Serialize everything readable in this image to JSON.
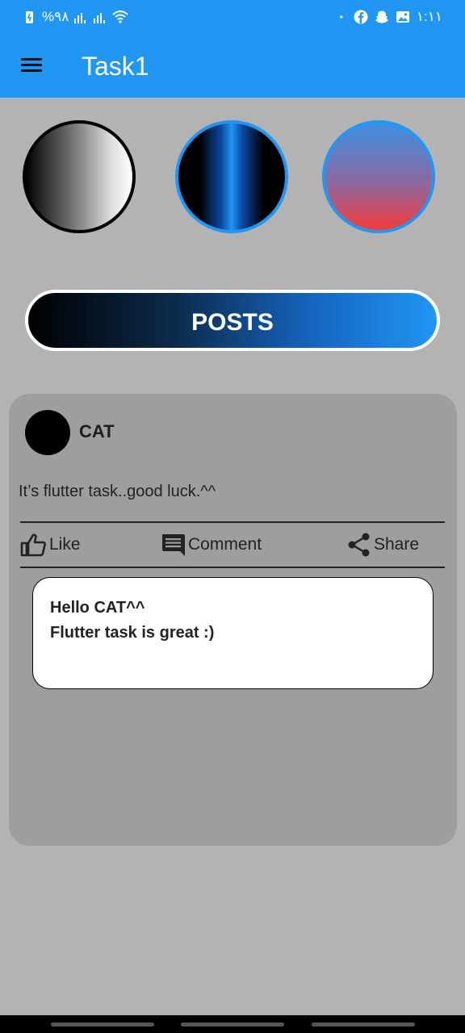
{
  "status_bar": {
    "battery_text": "%٩٨",
    "time": "١:١١",
    "icons": [
      "battery-icon",
      "signal-icon",
      "signal-icon",
      "wifi-icon",
      "dot-icon",
      "facebook-icon",
      "snapchat-icon",
      "gallery-icon"
    ]
  },
  "app_bar": {
    "title": "Task1",
    "background": "#2196f3"
  },
  "buttons": {
    "posts_label": "POSTS"
  },
  "post": {
    "author": "CAT",
    "text": "It’s flutter task..good luck.^^",
    "actions": {
      "like": "Like",
      "comment": "Comment",
      "share": "Share"
    },
    "comment": {
      "line1": "Hello CAT^^",
      "line2": "Flutter task is great :)"
    }
  }
}
